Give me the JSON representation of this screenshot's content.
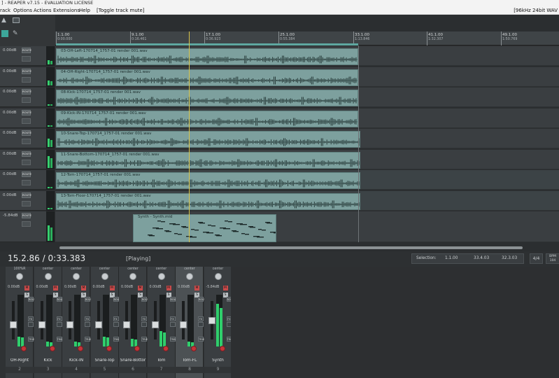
{
  "window": {
    "title": "] - REAPER v7.15 - EVALUATION LICENSE"
  },
  "menu": {
    "items": [
      "rack",
      "Options",
      "Actions",
      "Extensions",
      "Help"
    ],
    "status": "[Toggle track mute]",
    "format": "[96kHz 24bit WAV"
  },
  "ruler": {
    "ticks": [
      {
        "bar": "1.1.00",
        "time": "0:00.000"
      },
      {
        "bar": "9.1.00",
        "time": "0:16.461"
      },
      {
        "bar": "17.1.00",
        "time": "0:36.923"
      },
      {
        "bar": "25.1.00",
        "time": "0:55.384"
      },
      {
        "bar": "33.1.00",
        "time": "1:13.846"
      },
      {
        "bar": "41.1.00",
        "time": "1:32.307"
      },
      {
        "bar": "49.1.00",
        "time": "1:50.769"
      }
    ]
  },
  "tracks": [
    {
      "vol": "0.00dB",
      "route": "ROUTE",
      "item": "03-OH-Left-170714_1757-01 render 001.wav",
      "level": 0.25
    },
    {
      "vol": "0.00dB",
      "route": "ROUTE",
      "item": "04-OH-Right-170714_1757-01 render 001.wav",
      "level": 0.3
    },
    {
      "vol": "0.00dB",
      "route": "ROUTE",
      "item": "08-Kick-170714_1757-01 render 001.wav",
      "level": 0.1
    },
    {
      "vol": "0.00dB",
      "route": "ROUTE",
      "item": "09-Kick-IN-170714_1757-01 render 001.wav",
      "level": 0.1
    },
    {
      "vol": "0.00dB",
      "route": "ROUTE",
      "item": "10-Snare-Top-170714_1757-01 render 001.wav",
      "level": 0.5
    },
    {
      "vol": "0.00dB",
      "route": "ROUTE",
      "item": "11-Snare-Bottom-170714_1757-01 render 001.wav",
      "level": 0.7
    },
    {
      "vol": "0.00dB",
      "route": "ROUTE",
      "item": "12-Tom-170714_1757-01 render 001.wav",
      "level": 0.1
    },
    {
      "vol": "0.00dB",
      "route": "ROUTE",
      "item": "13-Tom-Floor-170714_1757-01 render 001.wav",
      "level": 0.1
    },
    {
      "vol": "-5.84dB",
      "route": "ROUTE",
      "item": "Synth - Synth.mid",
      "level": 0.9
    }
  ],
  "transport": {
    "position": "15.2.86 / 0:33.383",
    "state": "[Playing]",
    "selection_label": "Selection:",
    "sel_start": "1.1.00",
    "sel_end": "33.4.03",
    "sel_len": "32.3.03",
    "time_sig": "4/4",
    "bpm_label": "BPM",
    "bpm_value": "104"
  },
  "mixer": {
    "strips": [
      {
        "pan": "100%R",
        "db": "0.00dB",
        "name": "OH-Right",
        "num": "2",
        "level": 0.2,
        "fader": 0.35,
        "selected": false
      },
      {
        "pan": "center",
        "db": "0.00dB",
        "name": "Kick",
        "num": "3",
        "level": 0.1,
        "fader": 0.35,
        "selected": false
      },
      {
        "pan": "center",
        "db": "0.00dB",
        "name": "Kick-IN",
        "num": "4",
        "level": 0.1,
        "fader": 0.35,
        "selected": false
      },
      {
        "pan": "center",
        "db": "0.00dB",
        "name": "Snare-Top",
        "num": "5",
        "level": 0.2,
        "fader": 0.35,
        "selected": false
      },
      {
        "pan": "center",
        "db": "0.00dB",
        "name": "Snare-Bottor",
        "num": "6",
        "level": 0.15,
        "fader": 0.35,
        "selected": false
      },
      {
        "pan": "center",
        "db": "0.00dB",
        "name": "Tom",
        "num": "7",
        "level": 0.3,
        "fader": 0.35,
        "selected": false
      },
      {
        "pan": "center",
        "db": "0.00dB",
        "name": "Tom-FL",
        "num": "8",
        "level": 0.1,
        "fader": 0.35,
        "selected": true
      },
      {
        "pan": "center",
        "db": "-5.84dB",
        "name": "Synth",
        "num": "9",
        "level": 0.85,
        "fader": 0.5,
        "selected": false
      }
    ],
    "scale": [
      "-9.1",
      "-12",
      "-18",
      "-24",
      "-30",
      "-42",
      "-54"
    ],
    "strip_buttons": {
      "mute": "M",
      "solo": "S",
      "route": "ROUTE",
      "fx": "FX",
      "trim": "TRIM"
    }
  },
  "colors": {
    "item": "#7da09e",
    "meter": "#2fcf6c",
    "cursor": "#d8c34a",
    "record": "#c4343a"
  }
}
